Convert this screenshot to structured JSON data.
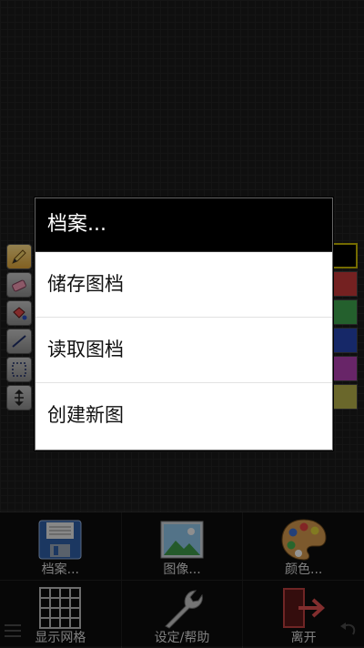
{
  "dialog": {
    "title": "档案...",
    "items": [
      {
        "label": "储存图档"
      },
      {
        "label": "读取图档"
      },
      {
        "label": "创建新图"
      }
    ]
  },
  "tools": [
    {
      "name": "pencil-icon"
    },
    {
      "name": "eraser-icon"
    },
    {
      "name": "fill-icon"
    },
    {
      "name": "line-icon"
    },
    {
      "name": "select-icon"
    },
    {
      "name": "move-icon"
    }
  ],
  "palette": {
    "colors": [
      "#000000",
      "#c83a3a",
      "#3ea64e",
      "#2746b4",
      "#b441b4",
      "#b7b14a"
    ]
  },
  "toolbar": {
    "file_label": "档案...",
    "image_label": "图像...",
    "color_label": "颜色...",
    "grid_label": "显示网格",
    "settings_label": "设定/帮助",
    "exit_label": "离开"
  }
}
